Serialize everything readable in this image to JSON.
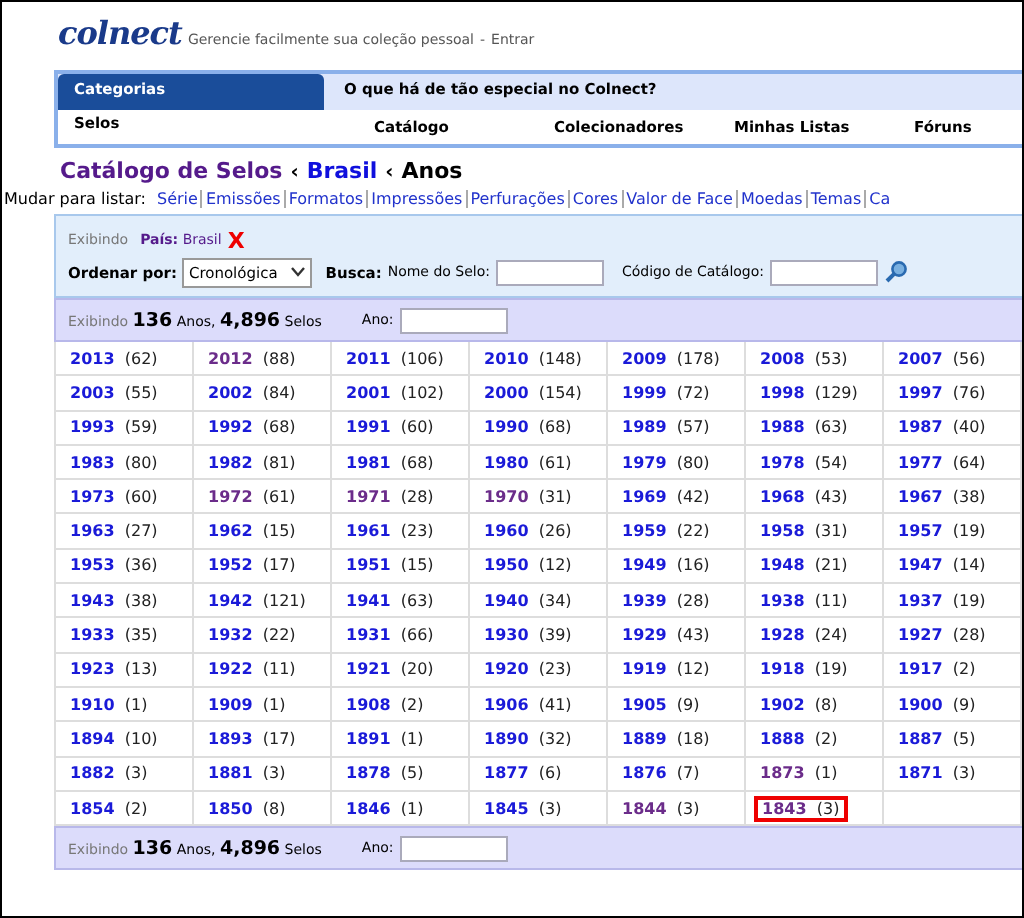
{
  "header": {
    "logo": "colnect",
    "tagline": "Gerencie facilmente sua coleção pessoal",
    "separator": "-",
    "login": "Entrar"
  },
  "nav": {
    "category_tab": "Categorias",
    "category": "Selos",
    "promo": "O que há de tão especial no Colnect?",
    "links": [
      "Catálogo",
      "Colecionadores",
      "Minhas Listas",
      "Fóruns"
    ]
  },
  "breadcrumb_separator": "‹",
  "breadcrumb": [
    {
      "label": "Catálogo de Selos",
      "kind": "visited"
    },
    {
      "label": "Brasil",
      "kind": "link"
    },
    {
      "label": "Anos",
      "kind": "current"
    }
  ],
  "list_switch": {
    "label": "Mudar para listar:",
    "links": [
      "Série",
      "Emissões",
      "Formatos",
      "Impressões",
      "Perfurações",
      "Cores",
      "Valor de Face",
      "Moedas",
      "Temas",
      "Ca"
    ]
  },
  "filter": {
    "showing": "Exibindo",
    "country_label": "País:",
    "country": "Brasil",
    "remove": "X",
    "sort_label": "Ordenar por:",
    "sort_value": "Cronológica",
    "search_label": "Busca:",
    "name_label": "Nome do Selo:",
    "code_label": "Código de Catálogo:"
  },
  "summary_top": {
    "showing": "Exibindo",
    "years": "136",
    "years_label": "Anos,",
    "stamps": "4,896",
    "stamps_label": "Selos",
    "year_label": "Ano:"
  },
  "years": [
    [
      {
        "year": "2013",
        "count": "(62)",
        "visited": false,
        "highlighted": false
      },
      {
        "year": "2012",
        "count": "(88)",
        "visited": true,
        "highlighted": false
      },
      {
        "year": "2011",
        "count": "(106)",
        "visited": false,
        "highlighted": false
      },
      {
        "year": "2010",
        "count": "(148)",
        "visited": false,
        "highlighted": false
      },
      {
        "year": "2009",
        "count": "(178)",
        "visited": false,
        "highlighted": false
      },
      {
        "year": "2008",
        "count": "(53)",
        "visited": false,
        "highlighted": false
      },
      {
        "year": "2007",
        "count": "(56)",
        "visited": false,
        "highlighted": false
      }
    ],
    [
      {
        "year": "2003",
        "count": "(55)",
        "visited": false,
        "highlighted": false
      },
      {
        "year": "2002",
        "count": "(84)",
        "visited": false,
        "highlighted": false
      },
      {
        "year": "2001",
        "count": "(102)",
        "visited": false,
        "highlighted": false
      },
      {
        "year": "2000",
        "count": "(154)",
        "visited": false,
        "highlighted": false
      },
      {
        "year": "1999",
        "count": "(72)",
        "visited": false,
        "highlighted": false
      },
      {
        "year": "1998",
        "count": "(129)",
        "visited": false,
        "highlighted": false
      },
      {
        "year": "1997",
        "count": "(76)",
        "visited": false,
        "highlighted": false
      }
    ],
    [
      {
        "year": "1993",
        "count": "(59)",
        "visited": false,
        "highlighted": false
      },
      {
        "year": "1992",
        "count": "(68)",
        "visited": false,
        "highlighted": false
      },
      {
        "year": "1991",
        "count": "(60)",
        "visited": false,
        "highlighted": false
      },
      {
        "year": "1990",
        "count": "(68)",
        "visited": false,
        "highlighted": false
      },
      {
        "year": "1989",
        "count": "(57)",
        "visited": false,
        "highlighted": false
      },
      {
        "year": "1988",
        "count": "(63)",
        "visited": false,
        "highlighted": false
      },
      {
        "year": "1987",
        "count": "(40)",
        "visited": false,
        "highlighted": false
      }
    ],
    [
      {
        "year": "1983",
        "count": "(80)",
        "visited": false,
        "highlighted": false
      },
      {
        "year": "1982",
        "count": "(81)",
        "visited": false,
        "highlighted": false
      },
      {
        "year": "1981",
        "count": "(68)",
        "visited": false,
        "highlighted": false
      },
      {
        "year": "1980",
        "count": "(61)",
        "visited": false,
        "highlighted": false
      },
      {
        "year": "1979",
        "count": "(80)",
        "visited": false,
        "highlighted": false
      },
      {
        "year": "1978",
        "count": "(54)",
        "visited": false,
        "highlighted": false
      },
      {
        "year": "1977",
        "count": "(64)",
        "visited": false,
        "highlighted": false
      }
    ],
    [
      {
        "year": "1973",
        "count": "(60)",
        "visited": false,
        "highlighted": false
      },
      {
        "year": "1972",
        "count": "(61)",
        "visited": true,
        "highlighted": false
      },
      {
        "year": "1971",
        "count": "(28)",
        "visited": true,
        "highlighted": false
      },
      {
        "year": "1970",
        "count": "(31)",
        "visited": true,
        "highlighted": false
      },
      {
        "year": "1969",
        "count": "(42)",
        "visited": false,
        "highlighted": false
      },
      {
        "year": "1968",
        "count": "(43)",
        "visited": false,
        "highlighted": false
      },
      {
        "year": "1967",
        "count": "(38)",
        "visited": false,
        "highlighted": false
      }
    ],
    [
      {
        "year": "1963",
        "count": "(27)",
        "visited": false,
        "highlighted": false
      },
      {
        "year": "1962",
        "count": "(15)",
        "visited": false,
        "highlighted": false
      },
      {
        "year": "1961",
        "count": "(23)",
        "visited": false,
        "highlighted": false
      },
      {
        "year": "1960",
        "count": "(26)",
        "visited": false,
        "highlighted": false
      },
      {
        "year": "1959",
        "count": "(22)",
        "visited": false,
        "highlighted": false
      },
      {
        "year": "1958",
        "count": "(31)",
        "visited": false,
        "highlighted": false
      },
      {
        "year": "1957",
        "count": "(19)",
        "visited": false,
        "highlighted": false
      }
    ],
    [
      {
        "year": "1953",
        "count": "(36)",
        "visited": false,
        "highlighted": false
      },
      {
        "year": "1952",
        "count": "(17)",
        "visited": false,
        "highlighted": false
      },
      {
        "year": "1951",
        "count": "(15)",
        "visited": false,
        "highlighted": false
      },
      {
        "year": "1950",
        "count": "(12)",
        "visited": false,
        "highlighted": false
      },
      {
        "year": "1949",
        "count": "(16)",
        "visited": false,
        "highlighted": false
      },
      {
        "year": "1948",
        "count": "(21)",
        "visited": false,
        "highlighted": false
      },
      {
        "year": "1947",
        "count": "(14)",
        "visited": false,
        "highlighted": false
      }
    ],
    [
      {
        "year": "1943",
        "count": "(38)",
        "visited": false,
        "highlighted": false
      },
      {
        "year": "1942",
        "count": "(121)",
        "visited": false,
        "highlighted": false
      },
      {
        "year": "1941",
        "count": "(63)",
        "visited": false,
        "highlighted": false
      },
      {
        "year": "1940",
        "count": "(34)",
        "visited": false,
        "highlighted": false
      },
      {
        "year": "1939",
        "count": "(28)",
        "visited": false,
        "highlighted": false
      },
      {
        "year": "1938",
        "count": "(11)",
        "visited": false,
        "highlighted": false
      },
      {
        "year": "1937",
        "count": "(19)",
        "visited": false,
        "highlighted": false
      }
    ],
    [
      {
        "year": "1933",
        "count": "(35)",
        "visited": false,
        "highlighted": false
      },
      {
        "year": "1932",
        "count": "(22)",
        "visited": false,
        "highlighted": false
      },
      {
        "year": "1931",
        "count": "(66)",
        "visited": false,
        "highlighted": false
      },
      {
        "year": "1930",
        "count": "(39)",
        "visited": false,
        "highlighted": false
      },
      {
        "year": "1929",
        "count": "(43)",
        "visited": false,
        "highlighted": false
      },
      {
        "year": "1928",
        "count": "(24)",
        "visited": false,
        "highlighted": false
      },
      {
        "year": "1927",
        "count": "(28)",
        "visited": false,
        "highlighted": false
      }
    ],
    [
      {
        "year": "1923",
        "count": "(13)",
        "visited": false,
        "highlighted": false
      },
      {
        "year": "1922",
        "count": "(11)",
        "visited": false,
        "highlighted": false
      },
      {
        "year": "1921",
        "count": "(20)",
        "visited": false,
        "highlighted": false
      },
      {
        "year": "1920",
        "count": "(23)",
        "visited": false,
        "highlighted": false
      },
      {
        "year": "1919",
        "count": "(12)",
        "visited": false,
        "highlighted": false
      },
      {
        "year": "1918",
        "count": "(19)",
        "visited": false,
        "highlighted": false
      },
      {
        "year": "1917",
        "count": "(2)",
        "visited": false,
        "highlighted": false
      }
    ],
    [
      {
        "year": "1910",
        "count": "(1)",
        "visited": false,
        "highlighted": false
      },
      {
        "year": "1909",
        "count": "(1)",
        "visited": false,
        "highlighted": false
      },
      {
        "year": "1908",
        "count": "(2)",
        "visited": false,
        "highlighted": false
      },
      {
        "year": "1906",
        "count": "(41)",
        "visited": false,
        "highlighted": false
      },
      {
        "year": "1905",
        "count": "(9)",
        "visited": false,
        "highlighted": false
      },
      {
        "year": "1902",
        "count": "(8)",
        "visited": false,
        "highlighted": false
      },
      {
        "year": "1900",
        "count": "(9)",
        "visited": false,
        "highlighted": false
      }
    ],
    [
      {
        "year": "1894",
        "count": "(10)",
        "visited": false,
        "highlighted": false
      },
      {
        "year": "1893",
        "count": "(17)",
        "visited": false,
        "highlighted": false
      },
      {
        "year": "1891",
        "count": "(1)",
        "visited": false,
        "highlighted": false
      },
      {
        "year": "1890",
        "count": "(32)",
        "visited": false,
        "highlighted": false
      },
      {
        "year": "1889",
        "count": "(18)",
        "visited": false,
        "highlighted": false
      },
      {
        "year": "1888",
        "count": "(2)",
        "visited": false,
        "highlighted": false
      },
      {
        "year": "1887",
        "count": "(5)",
        "visited": false,
        "highlighted": false
      }
    ],
    [
      {
        "year": "1882",
        "count": "(3)",
        "visited": false,
        "highlighted": false
      },
      {
        "year": "1881",
        "count": "(3)",
        "visited": false,
        "highlighted": false
      },
      {
        "year": "1878",
        "count": "(5)",
        "visited": false,
        "highlighted": false
      },
      {
        "year": "1877",
        "count": "(6)",
        "visited": false,
        "highlighted": false
      },
      {
        "year": "1876",
        "count": "(7)",
        "visited": false,
        "highlighted": false
      },
      {
        "year": "1873",
        "count": "(1)",
        "visited": true,
        "highlighted": false
      },
      {
        "year": "1871",
        "count": "(3)",
        "visited": false,
        "highlighted": false
      }
    ],
    [
      {
        "year": "1854",
        "count": "(2)",
        "visited": false,
        "highlighted": false
      },
      {
        "year": "1850",
        "count": "(8)",
        "visited": false,
        "highlighted": false
      },
      {
        "year": "1846",
        "count": "(1)",
        "visited": false,
        "highlighted": false
      },
      {
        "year": "1845",
        "count": "(3)",
        "visited": false,
        "highlighted": false
      },
      {
        "year": "1844",
        "count": "(3)",
        "visited": true,
        "highlighted": false
      },
      {
        "year": "1843",
        "count": "(3)",
        "visited": true,
        "highlighted": true
      }
    ]
  ],
  "summary_bottom": {
    "showing": "Exibindo",
    "years": "136",
    "years_label": "Anos,",
    "stamps": "4,896",
    "stamps_label": "Selos",
    "year_label": "Ano:"
  }
}
